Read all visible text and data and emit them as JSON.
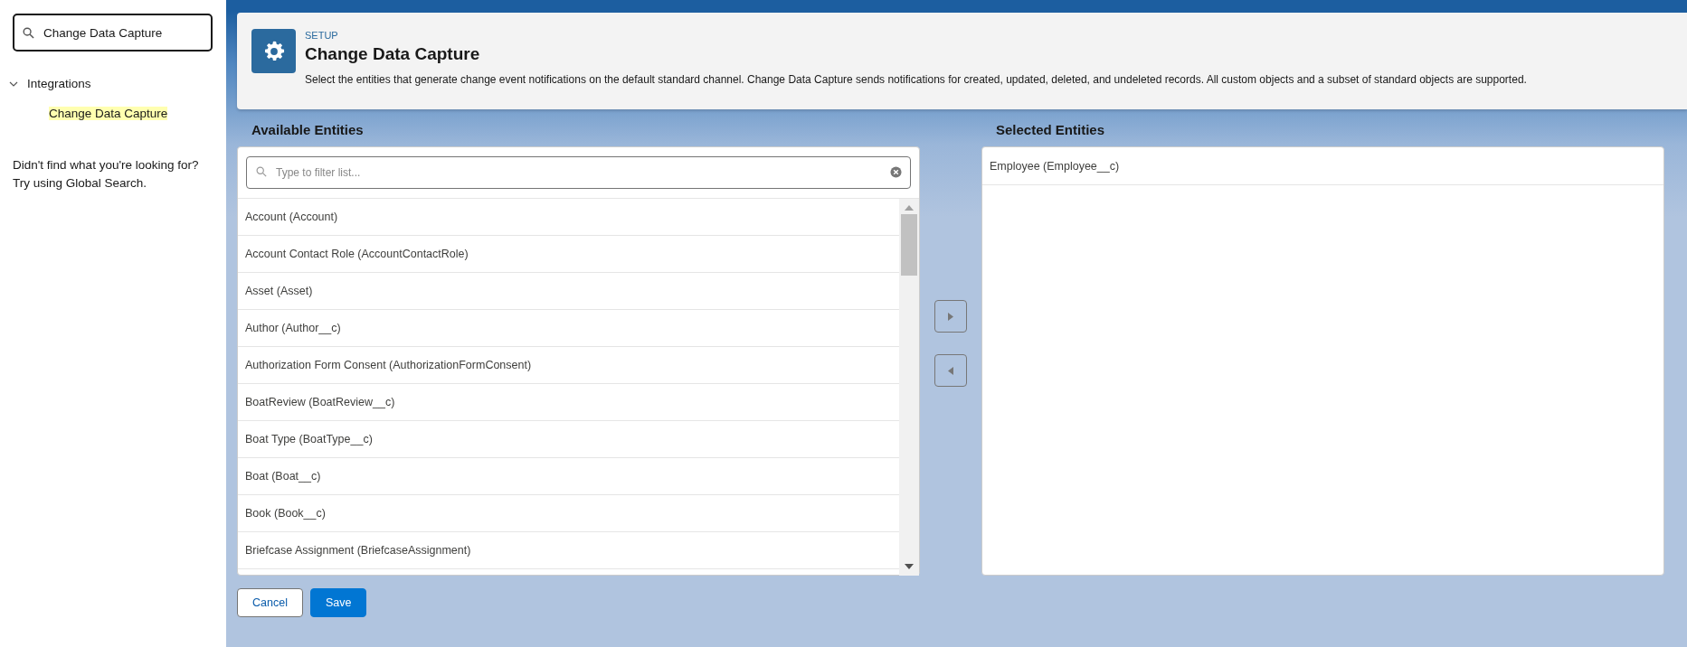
{
  "sidebar": {
    "search": {
      "value": "Change Data Capture"
    },
    "tree": [
      {
        "label": "Integrations",
        "expanded": true,
        "children": [
          {
            "label": "Change Data Capture",
            "highlighted": true
          }
        ]
      }
    ],
    "help": [
      "Didn't find what you're looking for?",
      "Try using Global Search."
    ]
  },
  "header": {
    "eyebrow": "SETUP",
    "title": "Change Data Capture",
    "description": "Select the entities that generate change event notifications on the default standard channel. Change Data Capture sends notifications for created, updated, deleted, and undeleted records. All custom objects and a subset of standard objects are supported."
  },
  "available": {
    "title": "Available Entities",
    "filter": {
      "placeholder": "Type to filter list..."
    },
    "items": [
      "Account (Account)",
      "Account Contact Role (AccountContactRole)",
      "Asset (Asset)",
      "Author (Author__c)",
      "Authorization Form Consent (AuthorizationFormConsent)",
      "BoatReview (BoatReview__c)",
      "Boat Type (BoatType__c)",
      "Boat (Boat__c)",
      "Book (Book__c)",
      "Briefcase Assignment (BriefcaseAssignment)"
    ]
  },
  "selected_entities": {
    "title": "Selected Entities",
    "items": [
      "Employee (Employee__c)"
    ]
  },
  "buttons": [
    {
      "label": "Cancel",
      "kind": "neutral"
    },
    {
      "label": "Save",
      "kind": "brand"
    }
  ]
}
